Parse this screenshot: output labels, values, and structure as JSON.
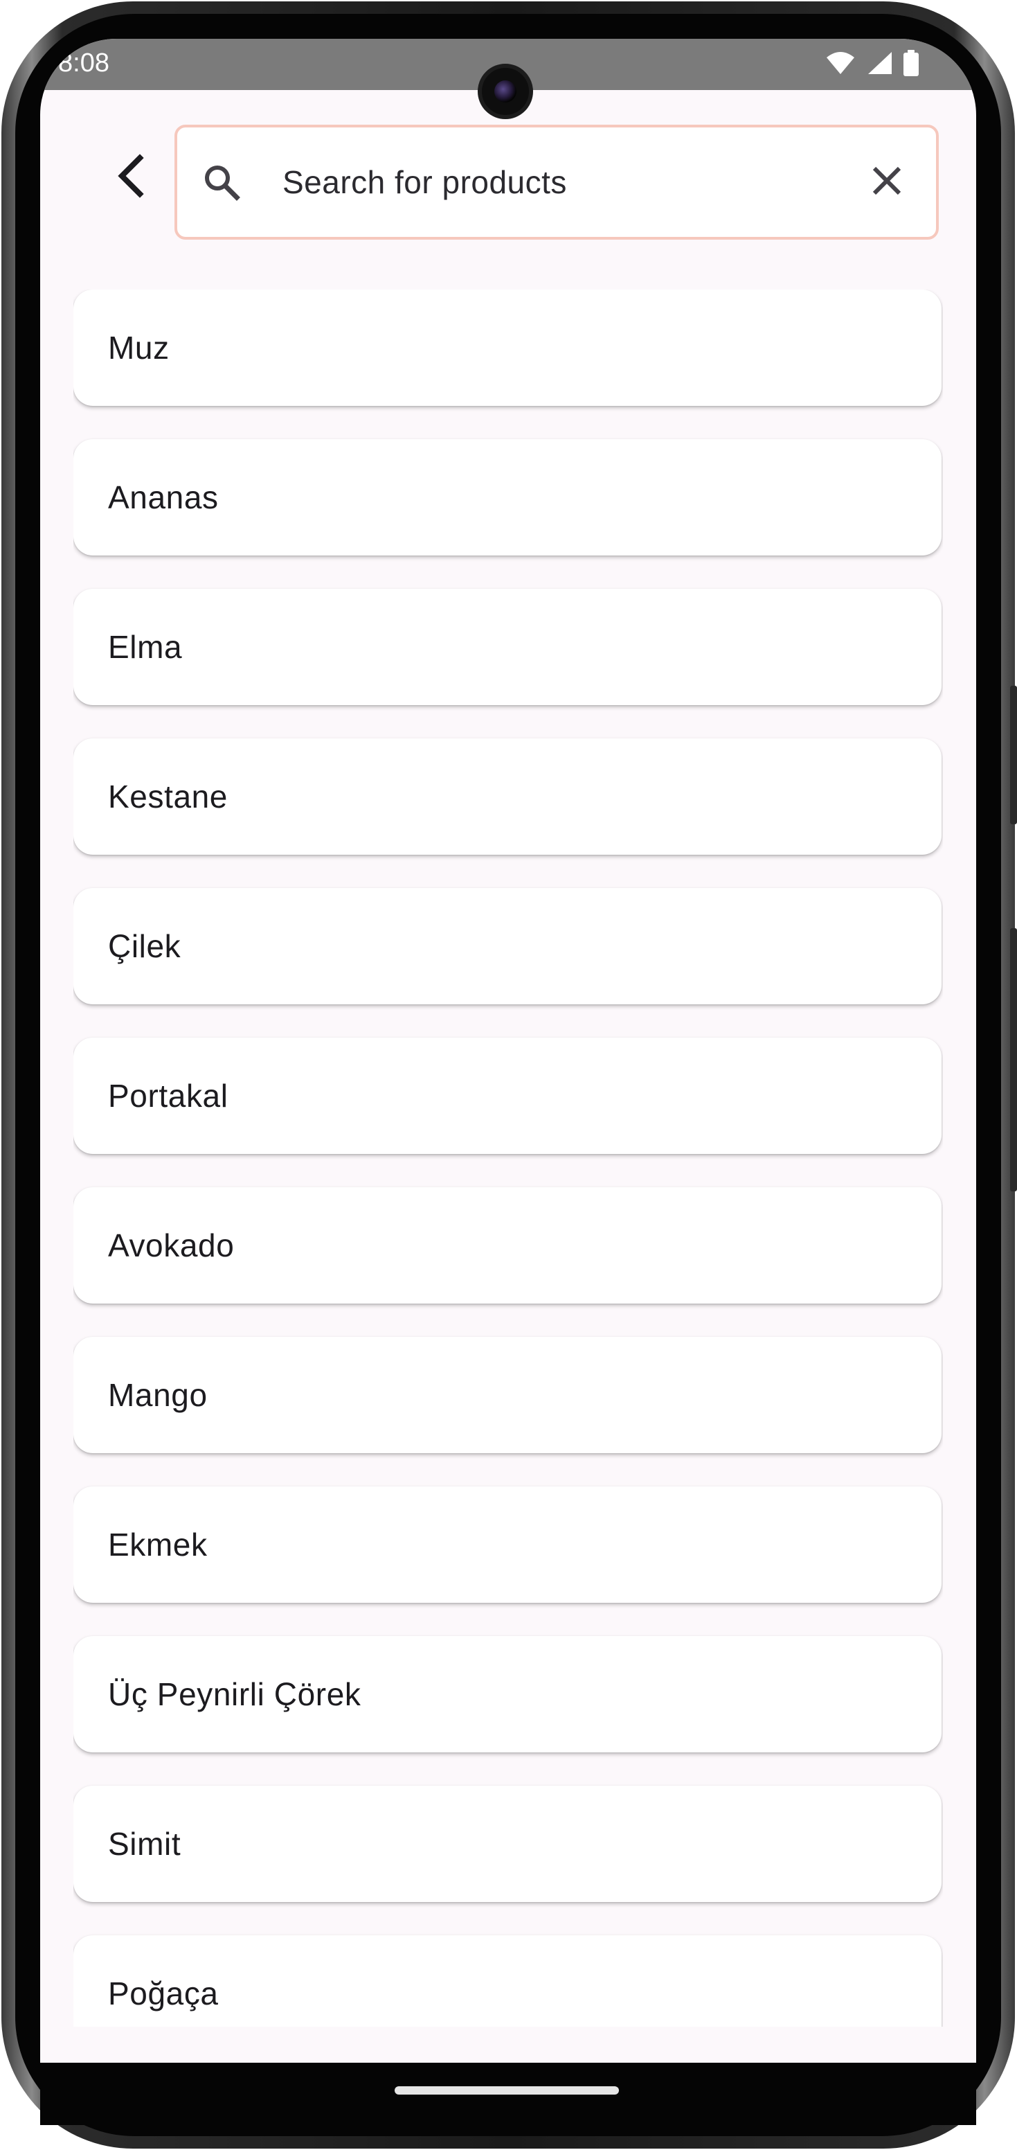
{
  "status_bar": {
    "time": "8:08",
    "icons": [
      "wifi-icon",
      "signal-icon",
      "battery-icon"
    ]
  },
  "header": {
    "back_icon": "chevron-left-icon",
    "search": {
      "placeholder": "Search for products",
      "value": "",
      "search_icon": "search-icon",
      "clear_icon": "close-icon",
      "border_color": "#f6c8bd"
    }
  },
  "products": [
    {
      "name": "Muz"
    },
    {
      "name": "Ananas"
    },
    {
      "name": "Elma"
    },
    {
      "name": "Kestane"
    },
    {
      "name": "Çilek"
    },
    {
      "name": "Portakal"
    },
    {
      "name": "Avokado"
    },
    {
      "name": "Mango"
    },
    {
      "name": "Ekmek"
    },
    {
      "name": "Üç Peynirli Çörek"
    },
    {
      "name": "Simit"
    },
    {
      "name": "Poğaça"
    }
  ],
  "colors": {
    "background": "#fcf8fb",
    "card": "#ffffff",
    "text": "#1c1b1f",
    "status_bar": "#7b7b7b"
  }
}
